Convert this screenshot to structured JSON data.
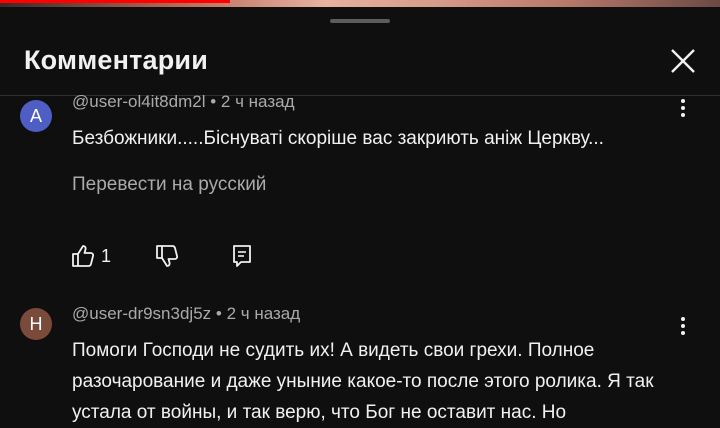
{
  "header": {
    "title": "Комментарии"
  },
  "comments": [
    {
      "avatar_letter": "A",
      "avatar_color": "#4f5ec4",
      "author": "@user-ol4it8dm2l",
      "time": "2 ч назад",
      "text": "Безбожники.....Біснуваті скоріше вас закриють аніж Церкву...",
      "translate": "Перевести на русский",
      "likes": "1"
    },
    {
      "avatar_letter": "Н",
      "avatar_color": "#7a4a3a",
      "author": "@user-dr9sn3dj5z",
      "time": "2 ч назад",
      "text": "Помоги Господи не судить их! А видеть свои грехи. Полное разочарование и даже уныние какое-то после этого ролика. Я так устала от войны, и так верю, что Бог не оставит нас. Но"
    }
  ],
  "icons": {
    "close": "close-icon",
    "like": "thumb-up-icon",
    "dislike": "thumb-down-icon",
    "reply": "reply-icon",
    "more": "more-vert-icon"
  },
  "colors": {
    "background": "#0f0f0f",
    "progress": "#ff0000",
    "secondary_text": "#aaaaaa"
  }
}
